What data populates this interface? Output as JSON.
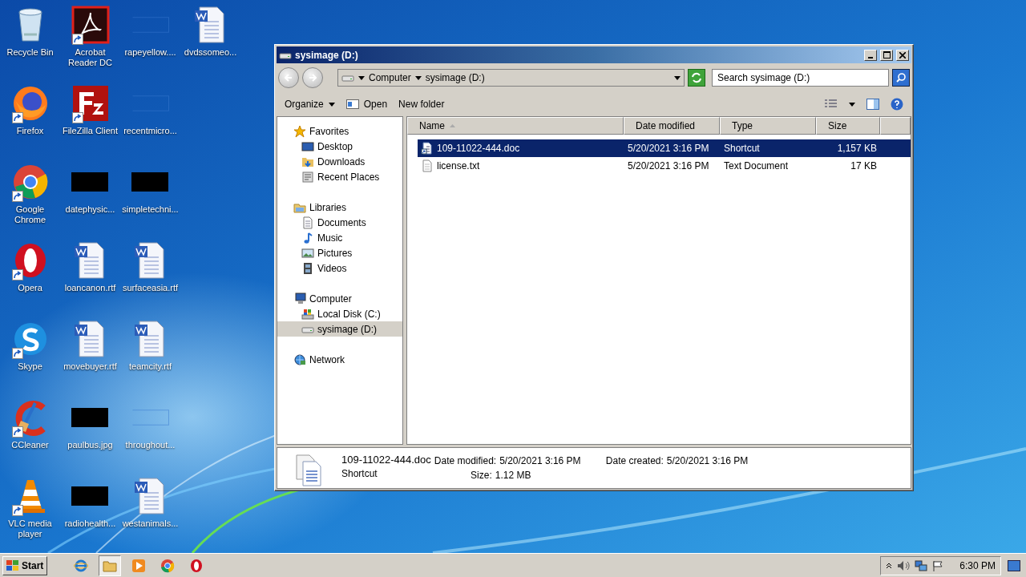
{
  "desktop_icons": [
    {
      "label": "Recycle Bin",
      "kind": "recycle",
      "shortcut": false
    },
    {
      "label": "Firefox",
      "kind": "firefox",
      "shortcut": true
    },
    {
      "label": "Google Chrome",
      "kind": "chrome",
      "shortcut": true
    },
    {
      "label": "Opera",
      "kind": "opera",
      "shortcut": true
    },
    {
      "label": "Skype",
      "kind": "skype",
      "shortcut": true
    },
    {
      "label": "CCleaner",
      "kind": "ccleaner",
      "shortcut": true
    },
    {
      "label": "VLC media player",
      "kind": "vlc",
      "shortcut": true
    },
    {
      "label": "Acrobat Reader DC",
      "kind": "acrobat",
      "shortcut": true
    },
    {
      "label": "FileZilla Client",
      "kind": "filezilla",
      "shortcut": true
    },
    {
      "label": "datephysic...",
      "kind": "black",
      "shortcut": false
    },
    {
      "label": "loancanon.rtf",
      "kind": "word",
      "shortcut": false
    },
    {
      "label": "movebuyer.rtf",
      "kind": "word",
      "shortcut": false
    },
    {
      "label": "paulbus.jpg",
      "kind": "black",
      "shortcut": false
    },
    {
      "label": "radiohealth...",
      "kind": "black",
      "shortcut": false
    },
    {
      "label": "rapeyellow....",
      "kind": "blank",
      "shortcut": false
    },
    {
      "label": "recentmicro...",
      "kind": "blank",
      "shortcut": false
    },
    {
      "label": "simpletechni...",
      "kind": "black",
      "shortcut": false
    },
    {
      "label": "surfaceasia.rtf",
      "kind": "word",
      "shortcut": false
    },
    {
      "label": "teamcity.rtf",
      "kind": "word",
      "shortcut": false
    },
    {
      "label": "throughout...",
      "kind": "blank",
      "shortcut": false
    },
    {
      "label": "westanimals...",
      "kind": "word",
      "shortcut": false
    },
    {
      "label": "dvdssomeo...",
      "kind": "word",
      "shortcut": false
    }
  ],
  "explorer": {
    "title": "sysimage (D:)",
    "breadcrumb": [
      "Computer",
      "sysimage (D:)"
    ],
    "search": {
      "placeholder": "Search sysimage (D:)"
    },
    "toolbar": [
      {
        "label": "Organize",
        "kind": "menu"
      },
      {
        "label": "Open",
        "kind": "open"
      },
      {
        "label": "New folder",
        "kind": "plain"
      }
    ],
    "nav": [
      {
        "label": "Favorites",
        "kind": "star",
        "selected": false,
        "children": [
          {
            "label": "Desktop",
            "kind": "desktop",
            "selected": false
          },
          {
            "label": "Downloads",
            "kind": "downloads",
            "selected": false
          },
          {
            "label": "Recent Places",
            "kind": "recent",
            "selected": false
          }
        ]
      },
      {
        "label": "Libraries",
        "kind": "library",
        "selected": false,
        "children": [
          {
            "label": "Documents",
            "kind": "documents",
            "selected": false
          },
          {
            "label": "Music",
            "kind": "music",
            "selected": false
          },
          {
            "label": "Pictures",
            "kind": "pictures",
            "selected": false
          },
          {
            "label": "Videos",
            "kind": "videos",
            "selected": false
          }
        ]
      },
      {
        "label": "Computer",
        "kind": "computer",
        "selected": false,
        "children": [
          {
            "label": "Local Disk (C:)",
            "kind": "localdisk",
            "selected": false
          },
          {
            "label": "sysimage (D:)",
            "kind": "drive",
            "selected": true
          }
        ]
      },
      {
        "label": "Network",
        "kind": "network",
        "selected": false
      }
    ],
    "columns": [
      {
        "label": "Name",
        "sorted": true
      },
      {
        "label": "Date modified",
        "sorted": false
      },
      {
        "label": "Type",
        "sorted": false
      },
      {
        "label": "Size",
        "sorted": false
      }
    ],
    "files": [
      {
        "name": "109-11022-444.doc",
        "date": "5/20/2021 3:16 PM",
        "type": "Shortcut",
        "size": "1,157 KB",
        "kind": "shortcut",
        "selected": true
      },
      {
        "name": "license.txt",
        "date": "5/20/2021 3:16 PM",
        "type": "Text Document",
        "size": "17 KB",
        "kind": "text",
        "selected": false
      }
    ],
    "details": {
      "name": "109-11022-444.doc",
      "type": "Shortcut",
      "fields": [
        {
          "label": "Date modified:",
          "value": "5/20/2021 3:16 PM"
        },
        {
          "label": "Date created:",
          "value": "5/20/2021 3:16 PM"
        },
        {
          "label": "Size:",
          "value": "1.12 MB"
        }
      ]
    }
  },
  "taskbar": {
    "start": "Start",
    "apps": [
      {
        "kind": "ie",
        "selected": false
      },
      {
        "kind": "explorer",
        "selected": true
      },
      {
        "kind": "media",
        "selected": false
      },
      {
        "kind": "chrome",
        "selected": false
      },
      {
        "kind": "opera",
        "selected": false
      }
    ],
    "clock": "6:30 PM"
  }
}
